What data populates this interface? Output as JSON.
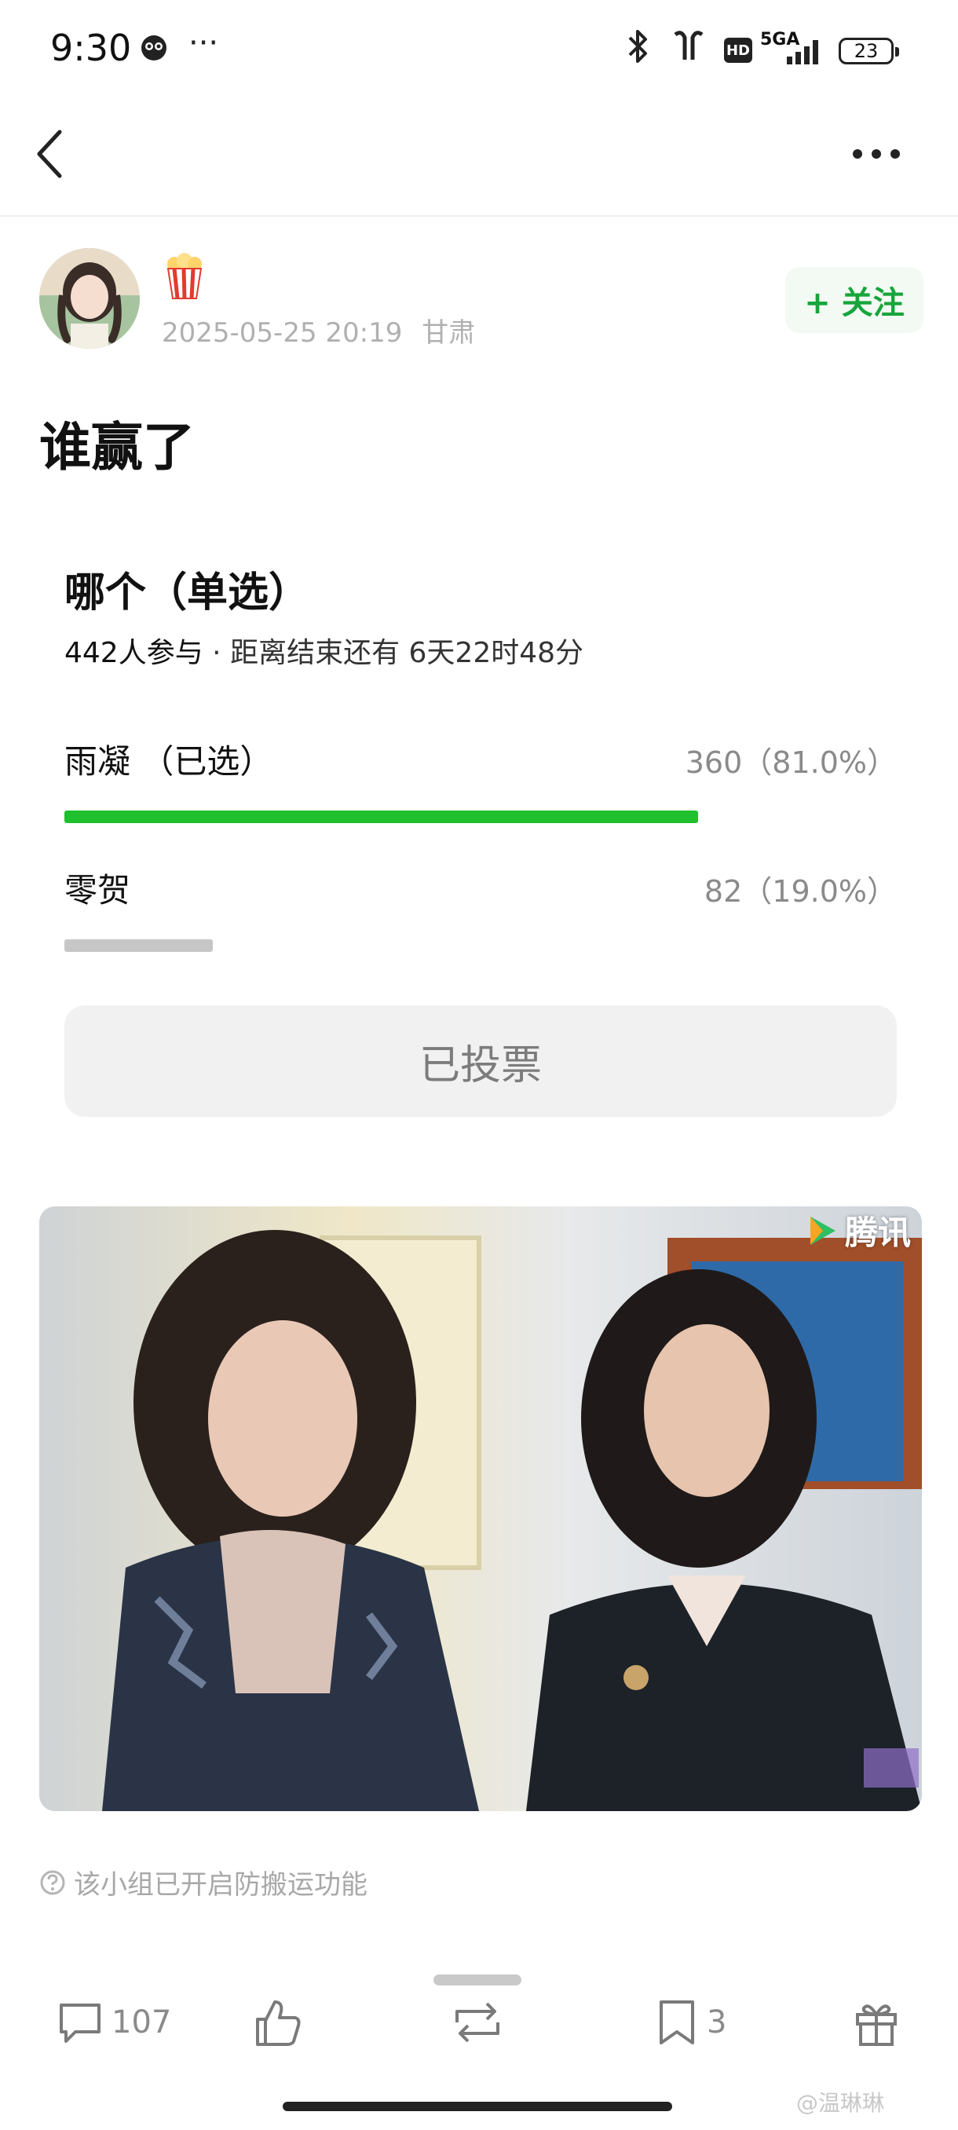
{
  "status_bar": {
    "time": "9:30",
    "more": "···",
    "network": "5GA",
    "hd": "HD",
    "battery": "23"
  },
  "nav": {
    "back": "back",
    "more": "more"
  },
  "post": {
    "date": "2025-05-25 20:19",
    "location": "甘肃",
    "follow_label": "+ 关注",
    "title": "谁赢了"
  },
  "poll": {
    "title": "哪个（单选）",
    "participants": "442人参与",
    "separator": " · ",
    "remaining": "距离结束还有 6天22时48分",
    "options": [
      {
        "label": "雨凝 （已选）",
        "value_text": "360（81.0%）",
        "votes": 360,
        "percent": 81.0,
        "selected": true
      },
      {
        "label": "零贺",
        "value_text": "82（19.0%）",
        "votes": 82,
        "percent": 19.0,
        "selected": false
      }
    ],
    "voted_label": "已投票"
  },
  "photo": {
    "watermark": "腾讯"
  },
  "notice": "该小组已开启防搬运功能",
  "bottom_bar": {
    "comments": "107",
    "reposts": "",
    "bookmarks": "3"
  },
  "watermark": "@温琳琳",
  "colors": {
    "accent": "#17a53b",
    "bar_selected": "#1fbf2e",
    "bar_other": "#c6c6c6"
  }
}
